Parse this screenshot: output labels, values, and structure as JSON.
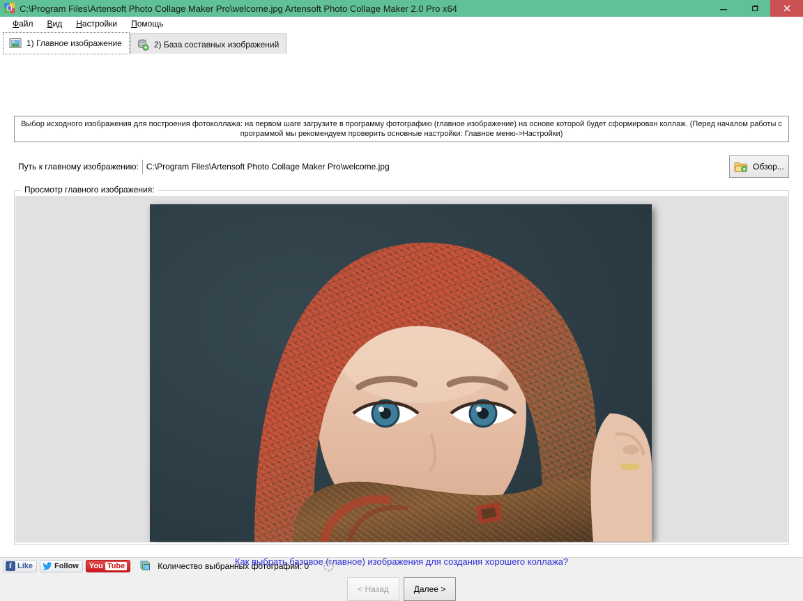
{
  "window": {
    "title": "C:\\Program Files\\Artensoft Photo Collage Maker Pro\\welcome.jpg Artensoft Photo Collage Maker  2.0 Pro x64",
    "app_icon": "collage-mosaic-icon",
    "titlebar_color": "#5fc195",
    "close_button_color": "#cb5252",
    "minimize_label": "–",
    "maximize_label": "❐",
    "close_label": "✕"
  },
  "menu": {
    "items": [
      {
        "label": "Файл",
        "accel": "Ф"
      },
      {
        "label": "Вид",
        "accel": "В"
      },
      {
        "label": "Настройки",
        "accel": "Н"
      },
      {
        "label": "Помощь",
        "accel": "П"
      }
    ]
  },
  "tabs": [
    {
      "label": "1) Главное изображение",
      "icon": "picture-icon",
      "active": true
    },
    {
      "label": "2) База составных изображений",
      "icon": "database-add-icon",
      "active": false
    }
  ],
  "info": {
    "text": "Выбор исходного изображения для построения фотоколлажа: на первом шаге загрузите в программу фотографию (главное изображение) на основе которой будет сформирован коллаж. (Перед началом работы с программой мы рекомендуем проверить основные настройки: Главное меню->Настройки)"
  },
  "path_row": {
    "label": "Путь к главному изображению:",
    "value": "C:\\Program Files\\Artensoft Photo Collage Maker Pro\\welcome.jpg",
    "placeholder": "",
    "browse_label": "Обзор...",
    "browse_icon": "folder-add-icon"
  },
  "preview": {
    "group_title": "Просмотр главного изображения:",
    "background_color": "#e1e1e1",
    "image_alt": "Фотография: девушка в красно-коричневом платке на тёмно-синем фоне",
    "image_colors": {
      "background": "#2f4049",
      "scarf_red": "#c0402f",
      "scarf_brown": "#7b5a3a",
      "skin": "#e8c3ac",
      "eye_blue": "#3f7d9b"
    }
  },
  "help_link": {
    "text": "Как выбрать базовое (главное) изображения для создания хорошего коллажа?",
    "color": "#2b2bd4"
  },
  "nav": {
    "back_label": "< Назад",
    "back_enabled": false,
    "next_label": "Далее >",
    "next_enabled": true
  },
  "statusbar": {
    "facebook_label": "Like",
    "facebook_glyph": "f",
    "twitter_label": "Follow",
    "twitter_glyph": "ᵗ",
    "youtube_label_1": "You",
    "youtube_label_2": "Tube",
    "count_icon": "photos-stack-icon",
    "count_text": "Количество выбранных фотографий: 0",
    "spinner": "loading-spinner-icon"
  }
}
